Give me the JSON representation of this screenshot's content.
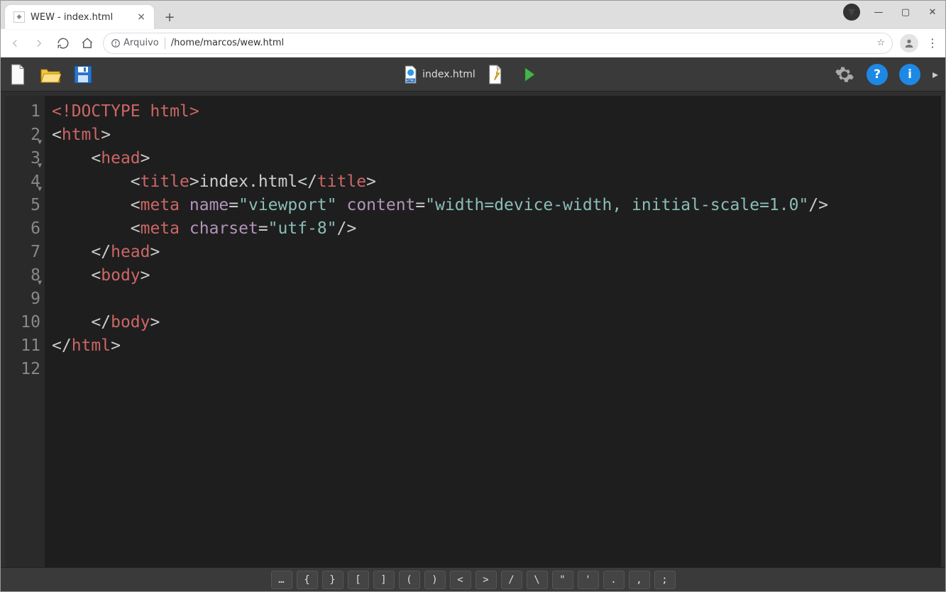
{
  "browser": {
    "tab_title": "WEW - index.html",
    "url_scheme_label": "Arquivo",
    "url_path": "/home/marcos/wew.html"
  },
  "toolbar": {
    "current_file": "index.html"
  },
  "editor": {
    "lines": [
      {
        "n": "1",
        "fold": false
      },
      {
        "n": "2",
        "fold": true
      },
      {
        "n": "3",
        "fold": true
      },
      {
        "n": "4",
        "fold": true
      },
      {
        "n": "5",
        "fold": false
      },
      {
        "n": "6",
        "fold": false
      },
      {
        "n": "7",
        "fold": false
      },
      {
        "n": "8",
        "fold": true
      },
      {
        "n": "9",
        "fold": false
      },
      {
        "n": "10",
        "fold": false
      },
      {
        "n": "11",
        "fold": false
      },
      {
        "n": "12",
        "fold": false
      }
    ],
    "code_tokens": [
      [
        [
          "t-red",
          "<!DOCTYPE html>"
        ]
      ],
      [
        [
          "t-punc",
          "<"
        ],
        [
          "t-red",
          "html"
        ],
        [
          "t-punc",
          ">"
        ]
      ],
      [
        [
          "t-punc",
          "    <"
        ],
        [
          "t-red",
          "head"
        ],
        [
          "t-punc",
          ">"
        ]
      ],
      [
        [
          "t-punc",
          "        <"
        ],
        [
          "t-red",
          "title"
        ],
        [
          "t-punc",
          ">"
        ],
        [
          "t-punc",
          "index.html"
        ],
        [
          "t-punc",
          "</"
        ],
        [
          "t-red",
          "title"
        ],
        [
          "t-punc",
          ">"
        ]
      ],
      [
        [
          "t-punc",
          "        <"
        ],
        [
          "t-red",
          "meta "
        ],
        [
          "t-attr",
          "name"
        ],
        [
          "t-punc",
          "="
        ],
        [
          "t-str",
          "\"viewport\""
        ],
        [
          "t-punc",
          " "
        ],
        [
          "t-attr",
          "content"
        ],
        [
          "t-punc",
          "="
        ],
        [
          "t-str",
          "\"width=device-width, initial-scale=1.0\""
        ],
        [
          "t-punc",
          "/>"
        ]
      ],
      [
        [
          "t-punc",
          "        <"
        ],
        [
          "t-red",
          "meta "
        ],
        [
          "t-attr",
          "charset"
        ],
        [
          "t-punc",
          "="
        ],
        [
          "t-str",
          "\"utf-8\""
        ],
        [
          "t-punc",
          "/>"
        ]
      ],
      [
        [
          "t-punc",
          "    </"
        ],
        [
          "t-red",
          "head"
        ],
        [
          "t-punc",
          ">"
        ]
      ],
      [
        [
          "t-punc",
          "    <"
        ],
        [
          "t-red",
          "body"
        ],
        [
          "t-punc",
          ">"
        ]
      ],
      [
        [
          "t-punc",
          ""
        ]
      ],
      [
        [
          "t-punc",
          "    </"
        ],
        [
          "t-red",
          "body"
        ],
        [
          "t-punc",
          ">"
        ]
      ],
      [
        [
          "t-punc",
          "</"
        ],
        [
          "t-red",
          "html"
        ],
        [
          "t-punc",
          ">"
        ]
      ],
      [
        [
          "t-punc",
          ""
        ]
      ]
    ]
  },
  "symbols": [
    "…",
    "{",
    "}",
    "[",
    "]",
    "(",
    ")",
    "<",
    ">",
    "/",
    "\\",
    "\"",
    "'",
    ".",
    ",",
    ";"
  ]
}
